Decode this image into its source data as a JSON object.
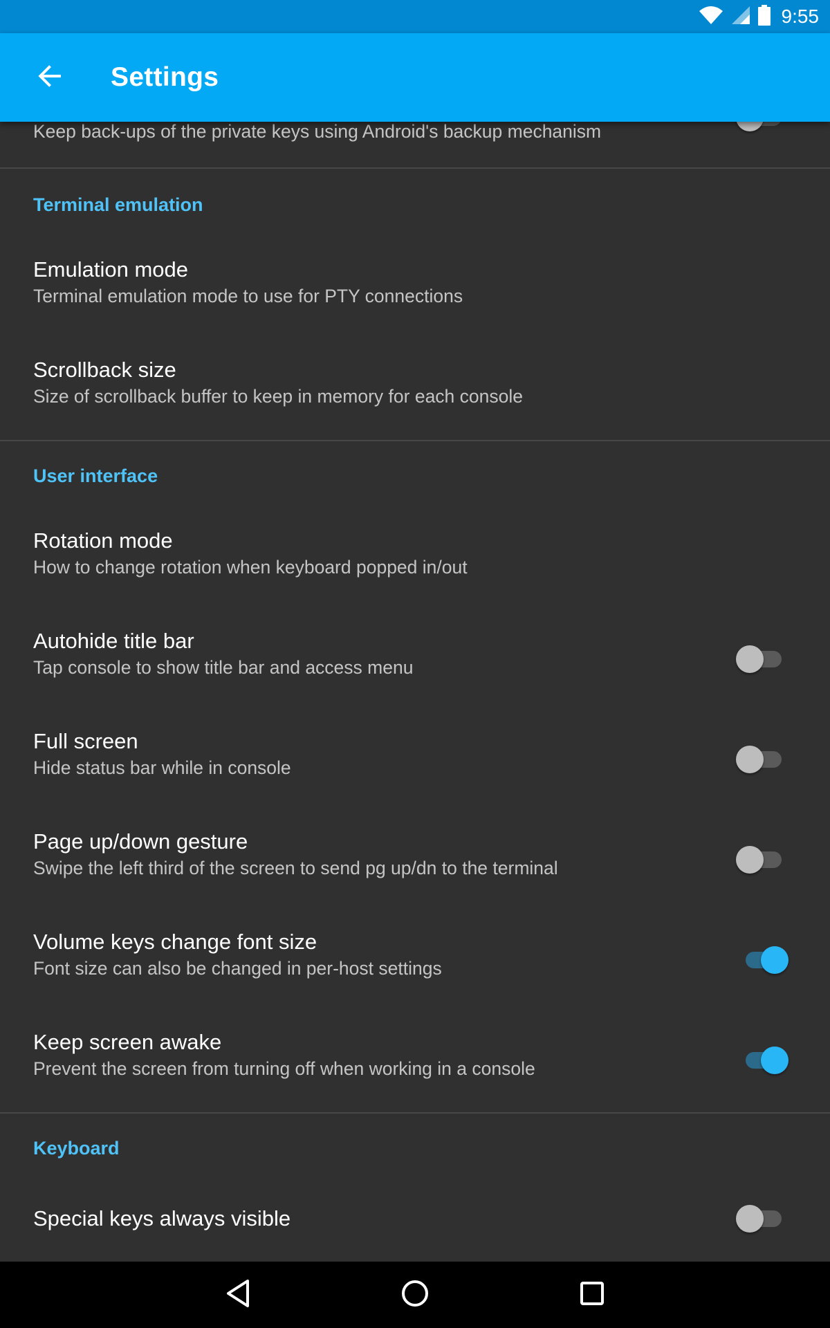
{
  "status_bar": {
    "time": "9:55",
    "icons": [
      "wifi-icon",
      "cell-signal-icon",
      "battery-icon"
    ]
  },
  "app_bar": {
    "title": "Settings",
    "back_icon": "arrow-back-icon"
  },
  "settings": {
    "partial_item": {
      "summary": "Keep back-ups of the private keys using Android's backup mechanism",
      "toggle_on": false
    },
    "terminal_emulation": {
      "header": "Terminal emulation",
      "items": [
        {
          "title": "Emulation mode",
          "summary": "Terminal emulation mode to use for PTY connections"
        },
        {
          "title": "Scrollback size",
          "summary": "Size of scrollback buffer to keep in memory for each console"
        }
      ]
    },
    "user_interface": {
      "header": "User interface",
      "items": [
        {
          "title": "Rotation mode",
          "summary": "How to change rotation when keyboard popped in/out"
        },
        {
          "title": "Autohide title bar",
          "summary": "Tap console to show title bar and access menu",
          "toggle_on": false
        },
        {
          "title": "Full screen",
          "summary": "Hide status bar while in console",
          "toggle_on": false
        },
        {
          "title": "Page up/down gesture",
          "summary": "Swipe the left third of the screen to send pg up/dn to the terminal",
          "toggle_on": false
        },
        {
          "title": "Volume keys change font size",
          "summary": "Font size can also be changed in per-host settings",
          "toggle_on": true
        },
        {
          "title": "Keep screen awake",
          "summary": "Prevent the screen from turning off when working in a console",
          "toggle_on": true
        }
      ]
    },
    "keyboard": {
      "header": "Keyboard",
      "items": [
        {
          "title": "Special keys always visible",
          "toggle_on": false
        }
      ]
    }
  },
  "nav_bar": {
    "icons": [
      "back-triangle-icon",
      "home-circle-icon",
      "recents-square-icon"
    ]
  },
  "colors": {
    "status_bar": "#0288d1",
    "app_bar": "#03a9f4",
    "background": "#303030",
    "category_text": "#4fc3f7",
    "switch_on": "#29b6f6"
  }
}
